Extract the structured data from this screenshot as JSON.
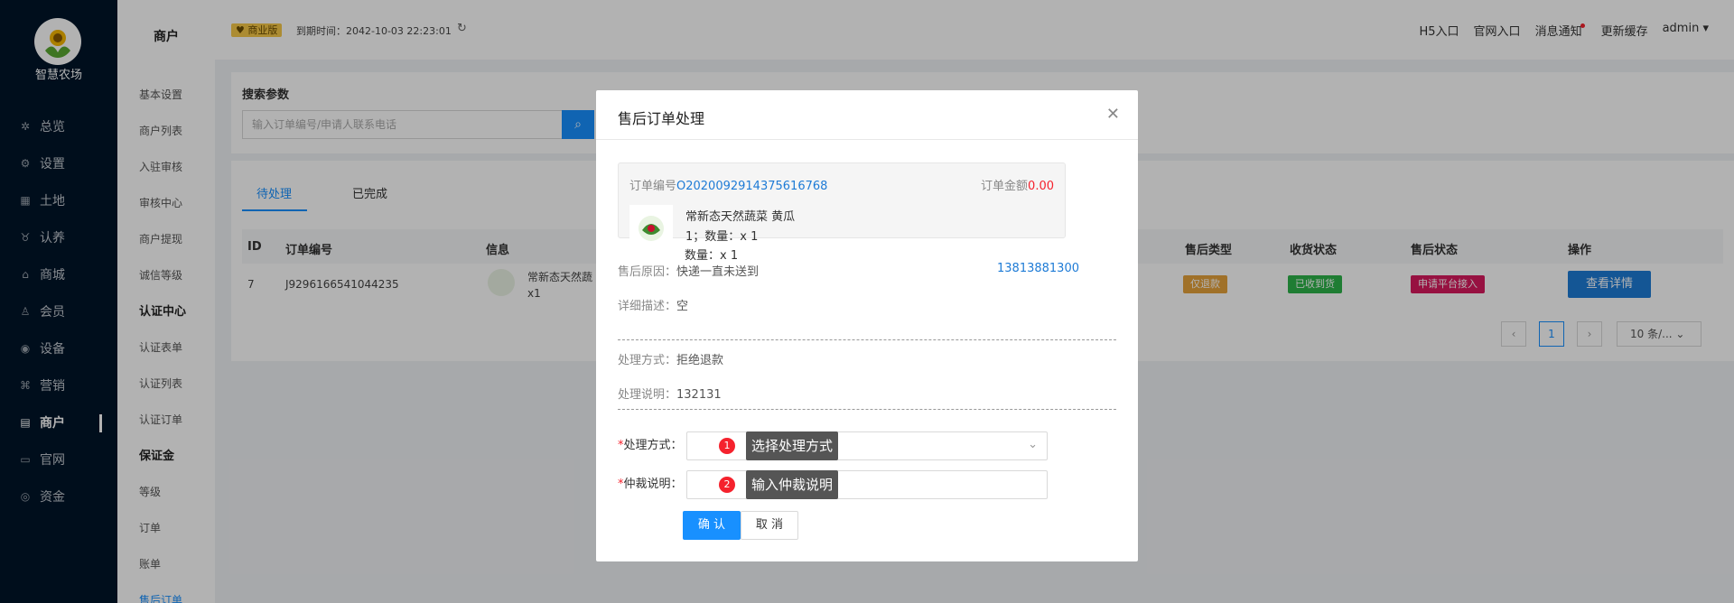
{
  "brand": {
    "name": "智慧农场"
  },
  "nav": {
    "items": [
      {
        "label": "总览",
        "icon": "dashboard-icon"
      },
      {
        "label": "设置",
        "icon": "gear-icon"
      },
      {
        "label": "土地",
        "icon": "land-icon"
      },
      {
        "label": "认养",
        "icon": "adopt-icon"
      },
      {
        "label": "商城",
        "icon": "store-icon"
      },
      {
        "label": "会员",
        "icon": "member-icon"
      },
      {
        "label": "设备",
        "icon": "device-icon"
      },
      {
        "label": "营销",
        "icon": "marketing-icon"
      },
      {
        "label": "商户",
        "icon": "merchant-icon"
      },
      {
        "label": "官网",
        "icon": "website-icon"
      },
      {
        "label": "资金",
        "icon": "funds-icon"
      }
    ],
    "active": "商户"
  },
  "subnav": {
    "title": "商户",
    "items": [
      "基本设置",
      "商户列表",
      "入驻审核",
      "审核中心",
      "商户提现",
      "诚信等级"
    ],
    "group1": "认证中心",
    "group1_items": [
      "认证表单",
      "认证列表",
      "认证订单"
    ],
    "group2": "保证金",
    "group2_items": [
      "等级",
      "订单",
      "账单",
      "售后订单"
    ]
  },
  "topbar": {
    "edition": "商业版",
    "expire": "到期时间：2042-10-03 22:23:01",
    "links": [
      "H5入口",
      "官网入口",
      "消息通知",
      "更新缓存",
      "admin"
    ]
  },
  "search": {
    "title": "搜索参数",
    "placeholder": "输入订单编号/申请人联系电话"
  },
  "tabs": [
    "待处理",
    "已完成"
  ],
  "table": {
    "headers": [
      "ID",
      "订单编号",
      "信息",
      "售后类型",
      "收货状态",
      "售后状态",
      "操作"
    ],
    "row": {
      "id": "7",
      "order_no": "J9296166541044235",
      "info": "常新态天然蔬",
      "info2": "x1",
      "type": "仅退款",
      "receive": "已收到货",
      "status": "申请平台接入",
      "action": "查看详情"
    }
  },
  "pagination": {
    "page": "1",
    "size": "10 条/..."
  },
  "modal": {
    "title": "售后订单处理",
    "order_label": "订单编号",
    "order_no": "O2020092914375616768",
    "amount_label": "订单金额",
    "amount": "0.00",
    "product": "常新态天然蔬菜 黄瓜",
    "spec": "1；数量：x 1",
    "qty": "数量：x 1",
    "reason_label": "售后原因：",
    "reason": "快递一直未送到",
    "phone": "13813881300",
    "desc_label": "详细描述：",
    "desc": "空",
    "method_label": "处理方式：",
    "method": "拒绝退款",
    "note_label": "处理说明：",
    "note": "132131",
    "form_method_label": "处理方式：",
    "form_arb_label": "仲裁说明：",
    "tip1": "选择处理方式",
    "tip2": "输入仲裁说明",
    "ok": "确 认",
    "cancel": "取 消"
  }
}
